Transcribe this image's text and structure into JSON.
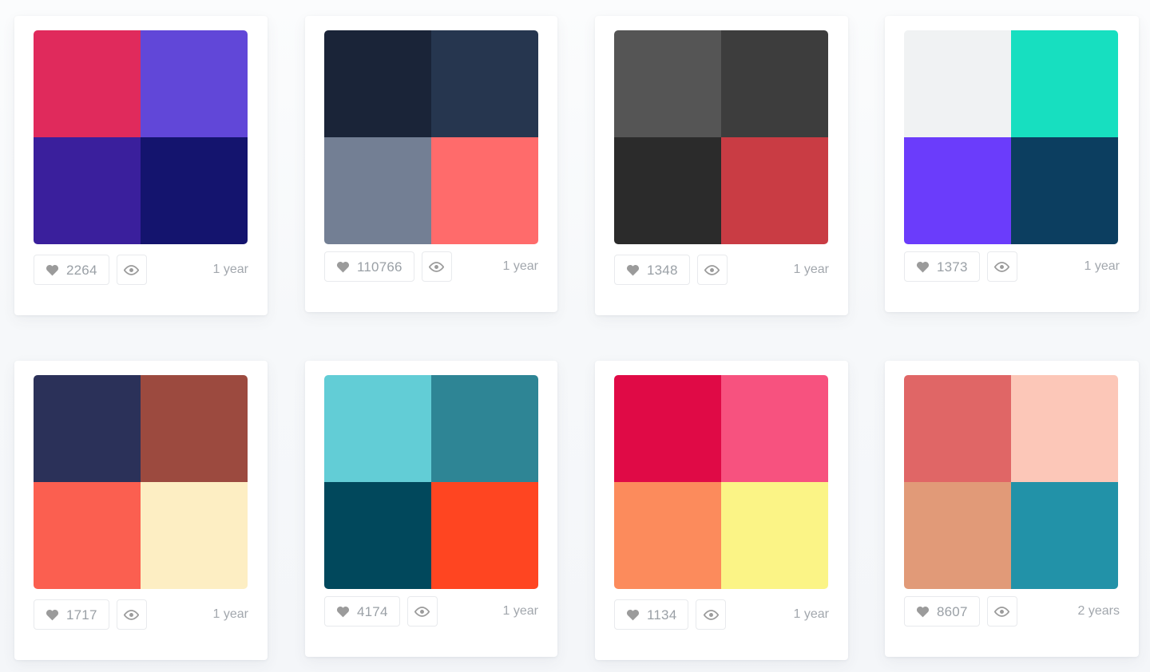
{
  "page": {
    "background_color": "#f8f9fb",
    "card_background": "#ffffff",
    "muted_text_color": "#9aa0a6",
    "icon_color": "#9b9b9b",
    "border_color": "#e8eaed"
  },
  "icons": {
    "heart": "heart-icon",
    "eye": "eye-icon"
  },
  "cards": [
    {
      "likes": "2264",
      "age": "1 year",
      "colors": [
        "#e02a5c",
        "#6147d8",
        "#3a1f9c",
        "#14146e"
      ]
    },
    {
      "likes": "110766",
      "age": "1 year",
      "colors": [
        "#1a2438",
        "#26364f",
        "#737f94",
        "#ff6b6b"
      ]
    },
    {
      "likes": "1348",
      "age": "1 year",
      "colors": [
        "#555555",
        "#3d3d3d",
        "#2b2b2b",
        "#c93c44"
      ]
    },
    {
      "likes": "1373",
      "age": "1 year",
      "colors": [
        "#f0f2f3",
        "#17dfc0",
        "#6b3cfb",
        "#0c3e60"
      ]
    },
    {
      "likes": "1717",
      "age": "1 year",
      "colors": [
        "#2b3159",
        "#9c4a3f",
        "#fb5f50",
        "#fdeec3"
      ]
    },
    {
      "likes": "4174",
      "age": "1 year",
      "colors": [
        "#62cdd6",
        "#2e8595",
        "#01485c",
        "#ff4521"
      ]
    },
    {
      "likes": "1134",
      "age": "1 year",
      "colors": [
        "#e00a46",
        "#f7527f",
        "#fc8b5c",
        "#fbf486"
      ]
    },
    {
      "likes": "8607",
      "age": "2 years",
      "colors": [
        "#e06666",
        "#fcc7b8",
        "#e19a78",
        "#2292a8"
      ]
    }
  ]
}
